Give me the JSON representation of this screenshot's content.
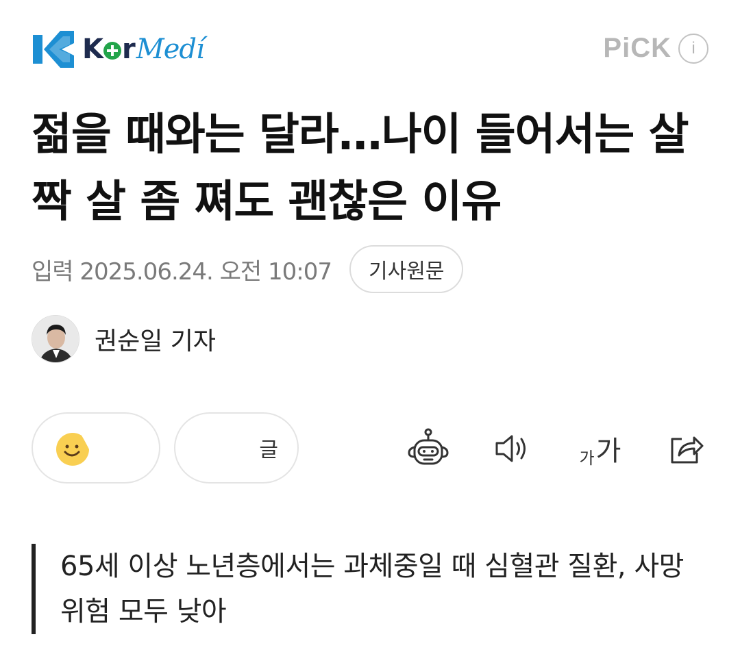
{
  "header": {
    "logo": {
      "k": "K",
      "r": "r",
      "medi": "Medí"
    },
    "pick_label": "PiCK",
    "info_icon_glyph": "i"
  },
  "article": {
    "headline": "젊을 때와는 달라…나이 들어서는 살짝 살 좀 쪄도 괜찮은 이유",
    "published": "입력 2025.06.24. 오전 10:07",
    "original_button": "기사원문",
    "reporter": "권순일 기자",
    "summary": "65세 이상 노년층에서는 과체중일 때 심혈관 질환, 사망 위험 모두 낮아"
  },
  "reactions": {
    "second_label": "글"
  },
  "toolbar": {
    "icons": [
      "robot-icon",
      "speaker-icon",
      "font-size-icon",
      "share-icon"
    ],
    "font_small": "가",
    "font_large": "가"
  },
  "colors": {
    "logo_navy": "#1e2b4e",
    "logo_blue": "#1d8fd3",
    "logo_green": "#23a54b",
    "muted_gray": "#7a7a7a"
  }
}
